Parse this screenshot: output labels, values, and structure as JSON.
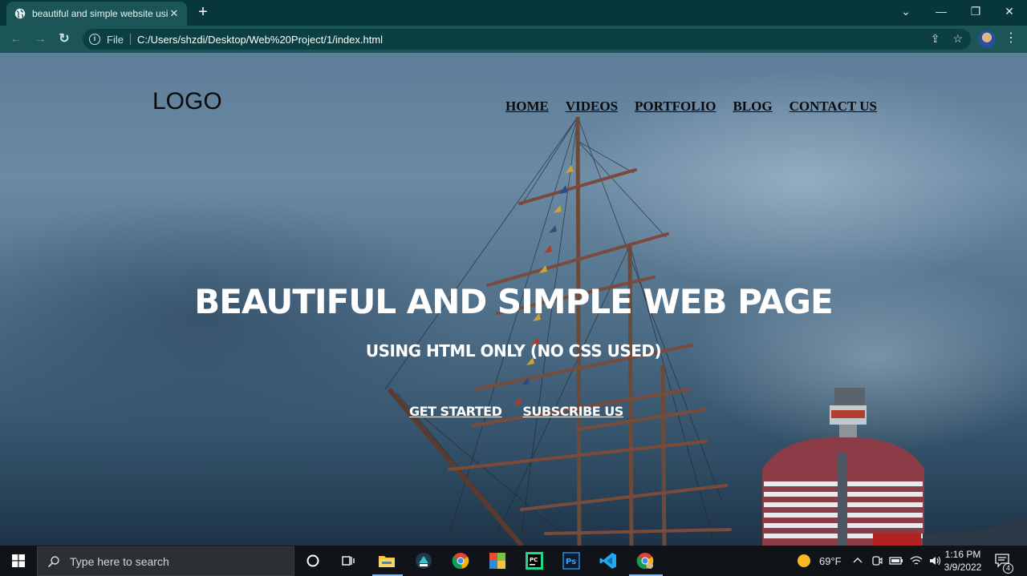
{
  "browser": {
    "tab_title": "beautiful and simple website usi",
    "close_glyph": "✕",
    "new_tab_glyph": "+",
    "window_controls": {
      "dropdown": "⌄",
      "minimize": "—",
      "restore": "❐",
      "close": "✕"
    },
    "back_glyph": "←",
    "forward_glyph": "→",
    "reload_glyph": "↻",
    "info_glyph": "i",
    "scheme_label": "File",
    "url": "C:/Users/shzdi/Desktop/Web%20Project/1/index.html",
    "share_glyph": "⇪",
    "bookmark_glyph": "☆",
    "menu_glyph": "⋮"
  },
  "page": {
    "logo": "LOGO",
    "nav": [
      "HOME",
      "VIDEOS",
      "PORTFOLIO",
      "BLOG",
      "CONTACT US"
    ],
    "heading": "BEAUTIFUL AND SIMPLE WEB PAGE",
    "subheading": "USING HTML ONLY (NO CSS USED)",
    "cta_primary": "GET STARTED",
    "cta_secondary": "SUBSCRIBE US"
  },
  "taskbar": {
    "search_placeholder": "Type here to search",
    "weather": "69°F",
    "time": "1:16 PM",
    "date": "3/9/2022",
    "notification_count": "4",
    "apps": [
      "cortana-icon",
      "task-view-icon",
      "file-explorer-icon",
      "store-icon",
      "chrome-icon",
      "app-icon",
      "pycharm-icon",
      "photoshop-icon",
      "vscode-icon",
      "chrome-active-icon"
    ]
  },
  "colors": {
    "tabbar": "#07373a",
    "toolbar": "#1b5557",
    "taskbar": "#101418",
    "accent": "#7bb8ff"
  }
}
